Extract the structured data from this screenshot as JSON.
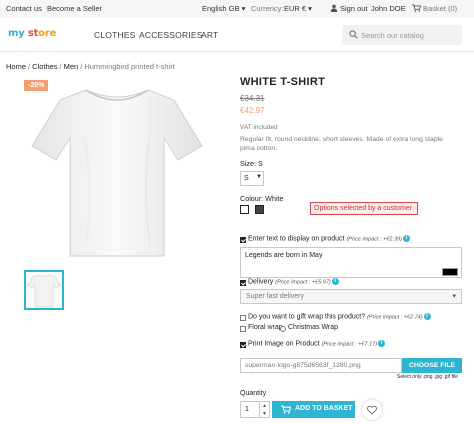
{
  "topbar": {
    "contact": "Contact us",
    "seller": "Become a Seller",
    "language": "English GB ▾",
    "currency_label": "Currency:",
    "currency_value": "EUR € ▾",
    "sign_out": "Sign out",
    "user_name": "John DOE",
    "basket": "Basket (0)"
  },
  "header": {
    "logo": {
      "part1": "my",
      "part2": " st",
      "part3": "ore"
    },
    "nav": [
      "CLOTHES",
      "ACCESSORIES",
      "ART"
    ],
    "search_placeholder": "Search our catalog"
  },
  "breadcrumb": [
    "Home",
    "Clothes",
    "Men",
    "Hummingbird printed t-shirt"
  ],
  "product": {
    "discount_badge": "-20%",
    "title": "WHITE T-SHIRT",
    "old_price": "€34.31",
    "price": "€42.97",
    "tax": "VAT included",
    "description": "Regular fit, round neckline, short sleeves. Made of extra long staple pima cotton.",
    "size_label": "Size: S",
    "size_value": "S",
    "colour_label": "Colour: White",
    "callout": "Options selected by a customer"
  },
  "options": {
    "text_label": "Enter text to display on product",
    "text_impact": "(Price impact : +€2.39)",
    "text_value": "Legends are born in May",
    "delivery_label": "Delivery",
    "delivery_impact": "(Price impact : +€5.97)",
    "delivery_value": "Super fast delivery",
    "giftwrap_label": "Do you want to gift wrap this product?",
    "giftwrap_impact": "(Price impact : +€2.74)",
    "floral_label": "Floral wrap",
    "christmas_label": "Christmas Wrap",
    "print_label": "Print Image on Product",
    "print_impact": "(Price impact : +€7.17)",
    "file_name": "superman-logo-g875d6563f_1280.png",
    "choose_file": "CHOOSE FILE",
    "file_hint": "Select only .png .jpg .gif file"
  },
  "purchase": {
    "quantity_label": "Quantity",
    "quantity_value": "1",
    "add_to_basket": "ADD TO BASKET"
  },
  "colors": {
    "accent": "#2fb5d2",
    "discount": "#f39d72",
    "callout_border": "#d94b4b"
  }
}
